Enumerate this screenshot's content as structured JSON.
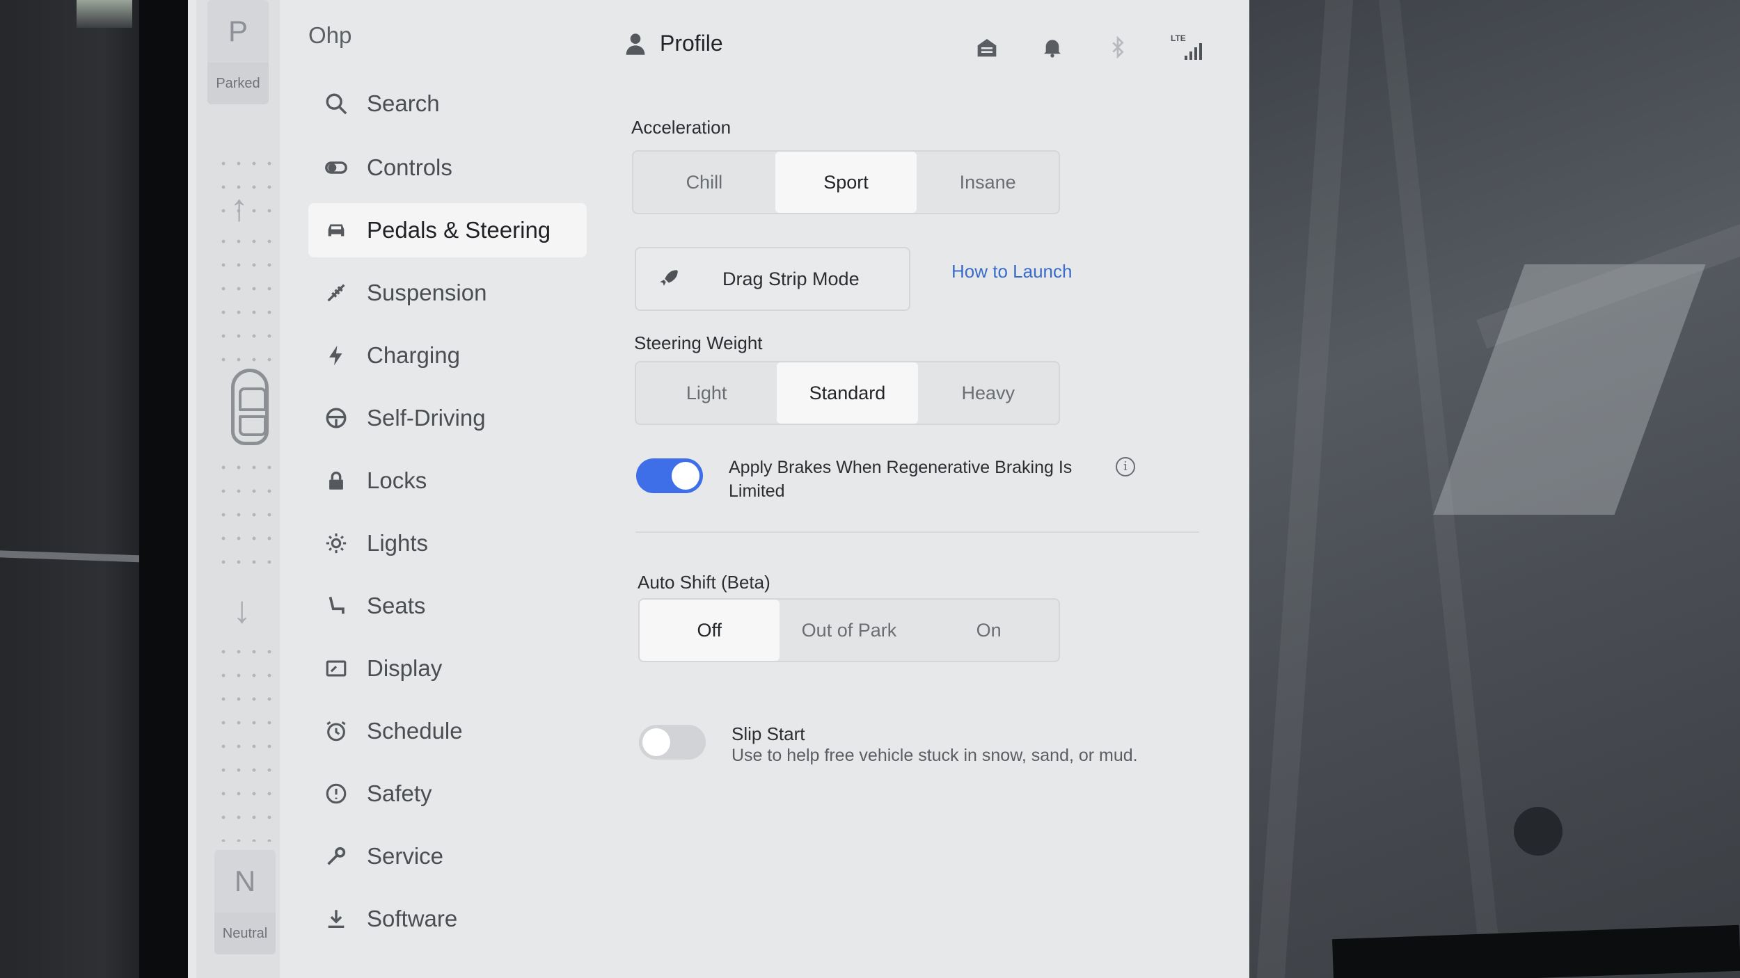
{
  "gear": {
    "top_letter": "P",
    "top_caption": "Parked",
    "bottom_letter": "N",
    "bottom_caption": "Neutral"
  },
  "sidebar": {
    "profile_name": "Ohp",
    "items": [
      {
        "label": "Search",
        "icon": "search-icon"
      },
      {
        "label": "Controls",
        "icon": "toggle-icon"
      },
      {
        "label": "Pedals & Steering",
        "icon": "car-icon",
        "active": true
      },
      {
        "label": "Suspension",
        "icon": "suspension-icon"
      },
      {
        "label": "Charging",
        "icon": "lightning-icon"
      },
      {
        "label": "Self-Driving",
        "icon": "steering-wheel-icon"
      },
      {
        "label": "Locks",
        "icon": "lock-icon"
      },
      {
        "label": "Lights",
        "icon": "sun-icon"
      },
      {
        "label": "Seats",
        "icon": "seat-icon"
      },
      {
        "label": "Display",
        "icon": "display-icon"
      },
      {
        "label": "Schedule",
        "icon": "alarm-clock-icon"
      },
      {
        "label": "Safety",
        "icon": "warning-circle-icon"
      },
      {
        "label": "Service",
        "icon": "wrench-icon"
      },
      {
        "label": "Software",
        "icon": "download-icon"
      }
    ]
  },
  "header": {
    "profile_label": "Profile",
    "status_icons": [
      "garage-icon",
      "bell-icon",
      "bluetooth-icon",
      "lte-signal-icon"
    ],
    "lte_label": "LTE"
  },
  "acceleration": {
    "label": "Acceleration",
    "options": [
      "Chill",
      "Sport",
      "Insane"
    ],
    "selected": "Sport"
  },
  "drag_strip": {
    "label": "Drag Strip Mode",
    "link": "How to Launch"
  },
  "steering_weight": {
    "label": "Steering Weight",
    "options": [
      "Light",
      "Standard",
      "Heavy"
    ],
    "selected": "Standard"
  },
  "apply_brakes": {
    "label": "Apply Brakes When Regenerative Braking Is Limited",
    "enabled": true
  },
  "auto_shift": {
    "label": "Auto Shift (Beta)",
    "options": [
      "Off",
      "Out of Park",
      "On"
    ],
    "selected": "Off"
  },
  "slip_start": {
    "title": "Slip Start",
    "description": "Use to help free vehicle stuck in snow, sand, or mud.",
    "enabled": false
  },
  "colors": {
    "accent": "#3e6ee8",
    "link": "#3a6cc9",
    "screen_bg": "#e7e8ea"
  }
}
